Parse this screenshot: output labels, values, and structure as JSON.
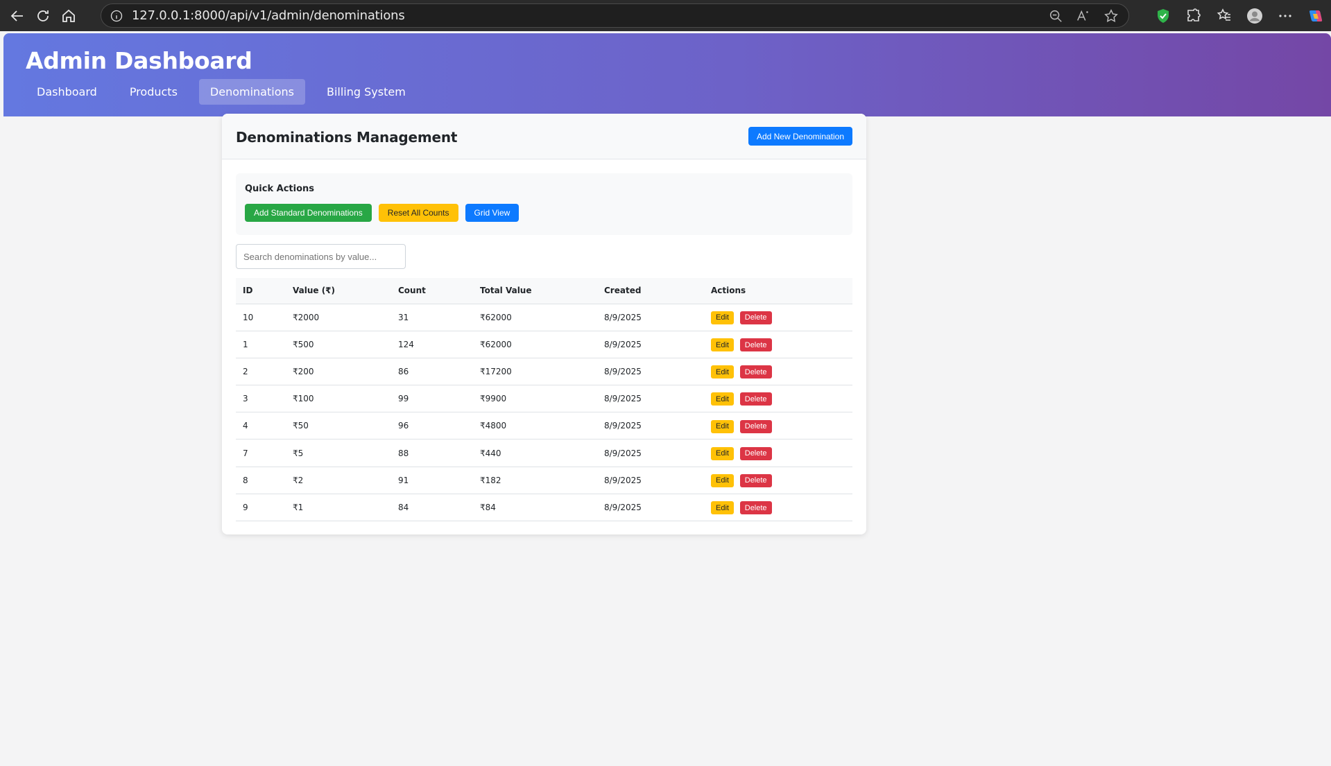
{
  "browser": {
    "url": "127.0.0.1:8000/api/v1/admin/denominations"
  },
  "header": {
    "title": "Admin Dashboard",
    "nav": [
      {
        "label": "Dashboard",
        "active": false
      },
      {
        "label": "Products",
        "active": false
      },
      {
        "label": "Denominations",
        "active": true
      },
      {
        "label": "Billing System",
        "active": false
      }
    ]
  },
  "card": {
    "title": "Denominations Management",
    "add_button": "Add New Denomination"
  },
  "quick_actions": {
    "title": "Quick Actions",
    "buttons": [
      {
        "label": "Add Standard Denominations"
      },
      {
        "label": "Reset All Counts"
      },
      {
        "label": "Grid View"
      }
    ]
  },
  "search": {
    "placeholder": "Search denominations by value..."
  },
  "table": {
    "headers": [
      "ID",
      "Value (₹)",
      "Count",
      "Total Value",
      "Created",
      "Actions"
    ],
    "edit_label": "Edit",
    "delete_label": "Delete",
    "rows": [
      {
        "id": "10",
        "value": "₹2000",
        "count": "31",
        "total": "₹62000",
        "created": "8/9/2025"
      },
      {
        "id": "1",
        "value": "₹500",
        "count": "124",
        "total": "₹62000",
        "created": "8/9/2025"
      },
      {
        "id": "2",
        "value": "₹200",
        "count": "86",
        "total": "₹17200",
        "created": "8/9/2025"
      },
      {
        "id": "3",
        "value": "₹100",
        "count": "99",
        "total": "₹9900",
        "created": "8/9/2025"
      },
      {
        "id": "4",
        "value": "₹50",
        "count": "96",
        "total": "₹4800",
        "created": "8/9/2025"
      },
      {
        "id": "7",
        "value": "₹5",
        "count": "88",
        "total": "₹440",
        "created": "8/9/2025"
      },
      {
        "id": "8",
        "value": "₹2",
        "count": "91",
        "total": "₹182",
        "created": "8/9/2025"
      },
      {
        "id": "9",
        "value": "₹1",
        "count": "84",
        "total": "₹84",
        "created": "8/9/2025"
      }
    ]
  },
  "colors": {
    "header_gradient_start": "#6478e0",
    "header_gradient_end": "#7447a6",
    "primary": "#0d7aff",
    "success": "#28a745",
    "warning": "#ffc107",
    "danger": "#dc3545"
  }
}
